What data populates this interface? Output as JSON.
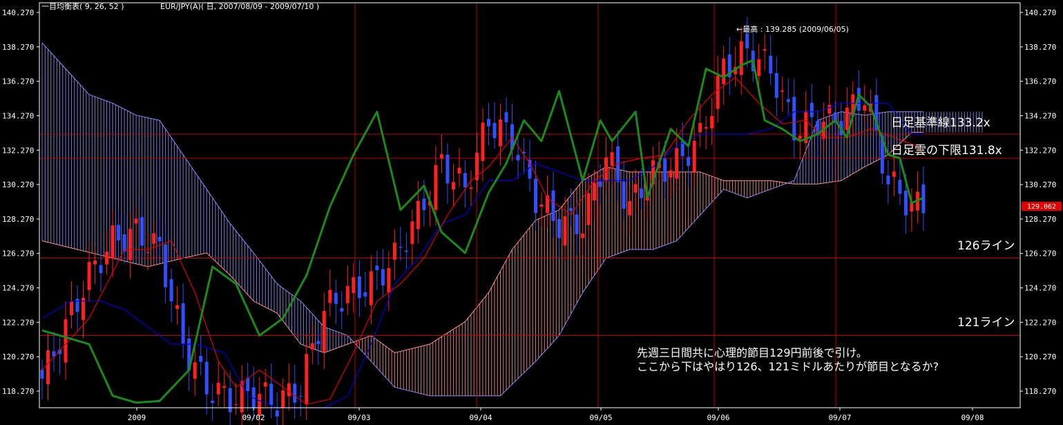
{
  "header": {
    "indicator": "一目均衡表( 9, 26, 52 )",
    "symbol": "EUR/JPY(A)( 日, 2007/08/09 - 2009/07/10 )"
  },
  "annotations": {
    "high": "←最高 : 139.285 (2009/06/05)",
    "kijun": "日足基準線133.2x",
    "cloud_low": "日足雲の下限131.8x",
    "line126": "126ライン",
    "line121": "121ライン",
    "comment_line1": "先週三日間共に心理的節目129円前後で引け。",
    "comment_line2": "ここから下はやはり126、121ミドルあたりが節目となるか?"
  },
  "chart_data": {
    "type": "candlestick",
    "title": "一目均衡表( 9, 26, 52 )",
    "symbol": "EUR/JPY(A)",
    "period": "日, 2007/08/09 - 2009/07/10",
    "ylim": [
      117.2,
      140.7
    ],
    "y_ticks": [
      "140.270",
      "138.270",
      "136.270",
      "134.270",
      "132.270",
      "130.270",
      "128.270",
      "126.270",
      "124.270",
      "122.270",
      "120.270",
      "118.270"
    ],
    "x_ticks": [
      "2009",
      "09/02",
      "09/03",
      "09/04",
      "09/05",
      "09/06",
      "09/07",
      "09/08"
    ],
    "current_price": "129.062",
    "horizontal_lines": [
      {
        "label": "日足基準線133.2x",
        "value": 133.2
      },
      {
        "label": "日足雲の下限131.8x",
        "value": 131.8
      },
      {
        "label": "126ライン",
        "value": 126.0
      },
      {
        "label": "121ライン",
        "value": 121.5
      }
    ],
    "recent_high": {
      "value": 139.285,
      "date": "2009/06/05"
    },
    "colors": {
      "bull": "#ff2020",
      "bear": "#3050ff",
      "tenkan": "#e00000",
      "kijun": "#0000e0",
      "chikou": "#1a8c1a",
      "cloud_pos": "#ff9090",
      "cloud_neg": "#9090ff",
      "grid": "#c00000",
      "axis": "#ffffff"
    },
    "series": [
      {
        "name": "chikou",
        "points": [
          [
            0,
            121.8
          ],
          [
            8,
            121.0
          ],
          [
            12,
            118.0
          ],
          [
            16,
            117.6
          ],
          [
            20,
            117.7
          ],
          [
            25,
            119.5
          ],
          [
            29,
            125.5
          ],
          [
            33,
            124.5
          ],
          [
            37,
            121.5
          ],
          [
            41,
            122.5
          ],
          [
            45,
            125.0
          ],
          [
            49,
            129.0
          ],
          [
            53,
            132.0
          ],
          [
            57,
            134.5
          ],
          [
            61,
            128.8
          ],
          [
            65,
            130.2
          ],
          [
            68,
            127.5
          ],
          [
            72,
            126.3
          ],
          [
            76,
            129.8
          ],
          [
            79,
            131.5
          ],
          [
            82,
            134.0
          ],
          [
            85,
            132.8
          ],
          [
            88,
            135.7
          ],
          [
            92,
            130.5
          ],
          [
            95,
            134.0
          ],
          [
            97,
            132.8
          ],
          [
            101,
            134.5
          ],
          [
            103,
            129.5
          ],
          [
            107,
            133.5
          ],
          [
            110,
            132.5
          ],
          [
            113,
            137.0
          ],
          [
            116,
            136.5
          ],
          [
            119,
            137.2
          ],
          [
            121,
            137.5
          ],
          [
            123,
            134.0
          ],
          [
            126,
            133.5
          ],
          [
            129,
            132.8
          ],
          [
            132,
            133.2
          ],
          [
            135,
            134.0
          ],
          [
            137,
            133.0
          ],
          [
            139,
            135.5
          ],
          [
            141,
            134.8
          ],
          [
            144,
            132.0
          ],
          [
            146,
            131.8
          ],
          [
            148,
            129.2
          ],
          [
            150,
            129.5
          ]
        ]
      },
      {
        "name": "tenkan",
        "points": [
          [
            0,
            119.5
          ],
          [
            8,
            122.5
          ],
          [
            14,
            126.5
          ],
          [
            18,
            126.5
          ],
          [
            22,
            127.0
          ],
          [
            26,
            124.0
          ],
          [
            30,
            120.0
          ],
          [
            33,
            118.5
          ],
          [
            37,
            119.5
          ],
          [
            41,
            118.5
          ],
          [
            45,
            117.5
          ],
          [
            49,
            117.8
          ],
          [
            53,
            120.5
          ],
          [
            57,
            123.5
          ],
          [
            61,
            124.5
          ],
          [
            65,
            126.0
          ],
          [
            69,
            128.5
          ],
          [
            73,
            130.5
          ],
          [
            76,
            131.3
          ],
          [
            80,
            133.0
          ],
          [
            83,
            131.5
          ],
          [
            86,
            129.5
          ],
          [
            90,
            128.5
          ],
          [
            94,
            130.5
          ],
          [
            98,
            131.5
          ],
          [
            102,
            131.8
          ],
          [
            106,
            132.0
          ],
          [
            110,
            134.0
          ],
          [
            114,
            135.5
          ],
          [
            118,
            136.5
          ],
          [
            122,
            135.0
          ],
          [
            126,
            133.8
          ],
          [
            130,
            134.0
          ],
          [
            133,
            133.0
          ],
          [
            137,
            133.0
          ],
          [
            141,
            133.5
          ],
          [
            145,
            133.0
          ],
          [
            149,
            132.5
          ],
          [
            150,
            132.0
          ]
        ]
      },
      {
        "name": "kijun",
        "points": [
          [
            0,
            122.5
          ],
          [
            5,
            123.5
          ],
          [
            10,
            123.5
          ],
          [
            14,
            123.0
          ],
          [
            18,
            122.0
          ],
          [
            22,
            121.0
          ],
          [
            26,
            121.0
          ],
          [
            31,
            120.5
          ],
          [
            35,
            118.0
          ],
          [
            40,
            117.3
          ],
          [
            44,
            117.3
          ],
          [
            48,
            117.3
          ],
          [
            52,
            118.0
          ],
          [
            56,
            121.0
          ],
          [
            60,
            124.5
          ],
          [
            64,
            126.0
          ],
          [
            68,
            128.0
          ],
          [
            72,
            128.5
          ],
          [
            76,
            130.5
          ],
          [
            80,
            130.5
          ],
          [
            84,
            131.5
          ],
          [
            88,
            131.0
          ],
          [
            92,
            130.5
          ],
          [
            96,
            130.5
          ],
          [
            100,
            130.5
          ],
          [
            104,
            131.3
          ],
          [
            108,
            132.5
          ],
          [
            112,
            133.2
          ],
          [
            116,
            133.2
          ],
          [
            120,
            133.2
          ],
          [
            124,
            133.5
          ],
          [
            128,
            134.5
          ],
          [
            132,
            134.5
          ],
          [
            136,
            135.0
          ],
          [
            140,
            135.0
          ],
          [
            144,
            135.0
          ],
          [
            148,
            133.2
          ],
          [
            150,
            133.2
          ]
        ]
      },
      {
        "name": "senkou_a",
        "points": [
          [
            0,
            127.0
          ],
          [
            6,
            126.5
          ],
          [
            12,
            126.0
          ],
          [
            18,
            125.5
          ],
          [
            24,
            126.0
          ],
          [
            28,
            126.3
          ],
          [
            32,
            125.0
          ],
          [
            36,
            123.5
          ],
          [
            40,
            122.8
          ],
          [
            44,
            121.0
          ],
          [
            48,
            120.5
          ],
          [
            52,
            121.0
          ],
          [
            56,
            121.5
          ],
          [
            60,
            120.5
          ],
          [
            66,
            121.0
          ],
          [
            72,
            122.3
          ],
          [
            76,
            124.0
          ],
          [
            80,
            126.5
          ],
          [
            84,
            128.2
          ],
          [
            88,
            128.8
          ],
          [
            92,
            130.5
          ],
          [
            96,
            131.3
          ],
          [
            100,
            131.0
          ],
          [
            104,
            131.0
          ],
          [
            108,
            131.0
          ],
          [
            112,
            131.0
          ],
          [
            116,
            130.5
          ],
          [
            120,
            130.5
          ],
          [
            124,
            130.5
          ],
          [
            128,
            130.3
          ],
          [
            132,
            130.3
          ],
          [
            136,
            130.5
          ],
          [
            140,
            131.3
          ],
          [
            144,
            132.0
          ],
          [
            148,
            133.3
          ],
          [
            150,
            133.3
          ]
        ]
      },
      {
        "name": "senkou_b",
        "points": [
          [
            0,
            138.5
          ],
          [
            4,
            137.0
          ],
          [
            8,
            135.5
          ],
          [
            12,
            135.0
          ],
          [
            16,
            134.3
          ],
          [
            20,
            134.0
          ],
          [
            24,
            132.0
          ],
          [
            28,
            130.0
          ],
          [
            32,
            128.0
          ],
          [
            36,
            126.3
          ],
          [
            40,
            124.5
          ],
          [
            44,
            123.5
          ],
          [
            48,
            122.0
          ],
          [
            52,
            121.5
          ],
          [
            56,
            120.0
          ],
          [
            60,
            118.5
          ],
          [
            66,
            118.0
          ],
          [
            72,
            118.0
          ],
          [
            78,
            118.0
          ],
          [
            84,
            120.0
          ],
          [
            88,
            121.5
          ],
          [
            92,
            124.0
          ],
          [
            96,
            126.0
          ],
          [
            100,
            126.5
          ],
          [
            104,
            126.5
          ],
          [
            108,
            127.0
          ],
          [
            112,
            128.5
          ],
          [
            116,
            130.0
          ],
          [
            120,
            129.5
          ],
          [
            124,
            130.0
          ],
          [
            128,
            130.5
          ],
          [
            132,
            134.0
          ],
          [
            136,
            134.5
          ],
          [
            140,
            134.3
          ],
          [
            144,
            134.5
          ],
          [
            148,
            134.5
          ],
          [
            150,
            134.5
          ]
        ]
      }
    ]
  }
}
